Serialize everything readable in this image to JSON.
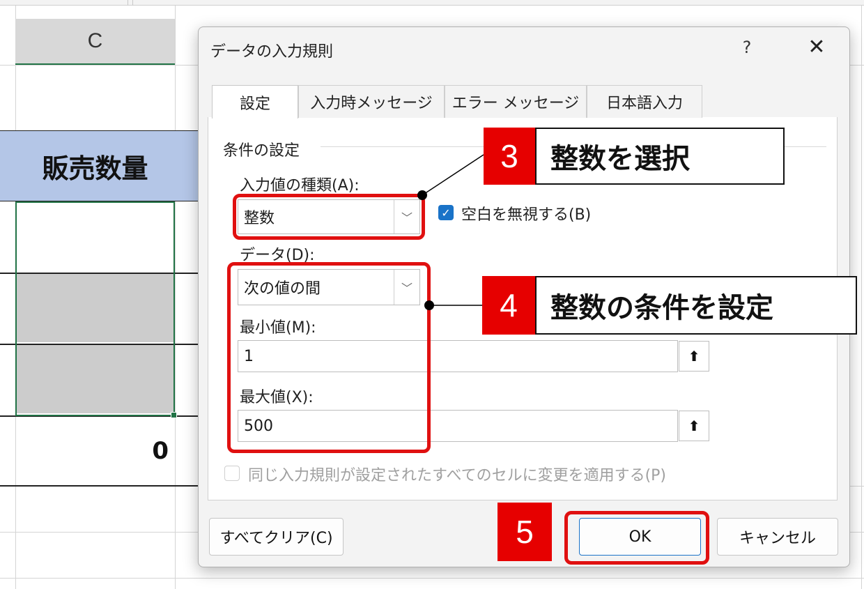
{
  "sheet": {
    "column_header": "C",
    "header_cell": "販売数量",
    "total_cell": "0"
  },
  "dialog": {
    "title": "データの入力規則",
    "help_glyph": "?",
    "close_glyph": "✕",
    "tabs": [
      "設定",
      "入力時メッセージ",
      "エラー メッセージ",
      "日本語入力"
    ],
    "group_label": "条件の設定",
    "allow_label": "入力値の種類(A):",
    "allow_value": "整数",
    "ignore_blank_label": "空白を無視する(B)",
    "ignore_blank_checked": true,
    "data_label": "データ(D):",
    "data_value": "次の値の間",
    "min_label": "最小値(M):",
    "min_value": "1",
    "max_label": "最大値(X):",
    "max_value": "500",
    "apply_all_label": "同じ入力規則が設定されたすべてのセルに変更を適用する(P)",
    "apply_all_checked": false,
    "clear_all_button": "すべてクリア(C)",
    "ok_button": "OK",
    "cancel_button": "キャンセル",
    "dropdown_glyph": "﹀",
    "ref_glyph": "⬆"
  },
  "annotations": {
    "step3": {
      "number": "3",
      "text": "整数を選択"
    },
    "step4": {
      "number": "4",
      "text": "整数の条件を設定"
    },
    "step5": {
      "number": "5"
    }
  },
  "colors": {
    "annotation_red": "#e60000",
    "header_blue": "#b4c6e7",
    "excel_green": "#217346",
    "checkbox_blue": "#1a73c8"
  },
  "icons": [
    "help-icon",
    "close-icon",
    "chevron-down-icon",
    "range-select-icon",
    "checkbox-icon"
  ]
}
